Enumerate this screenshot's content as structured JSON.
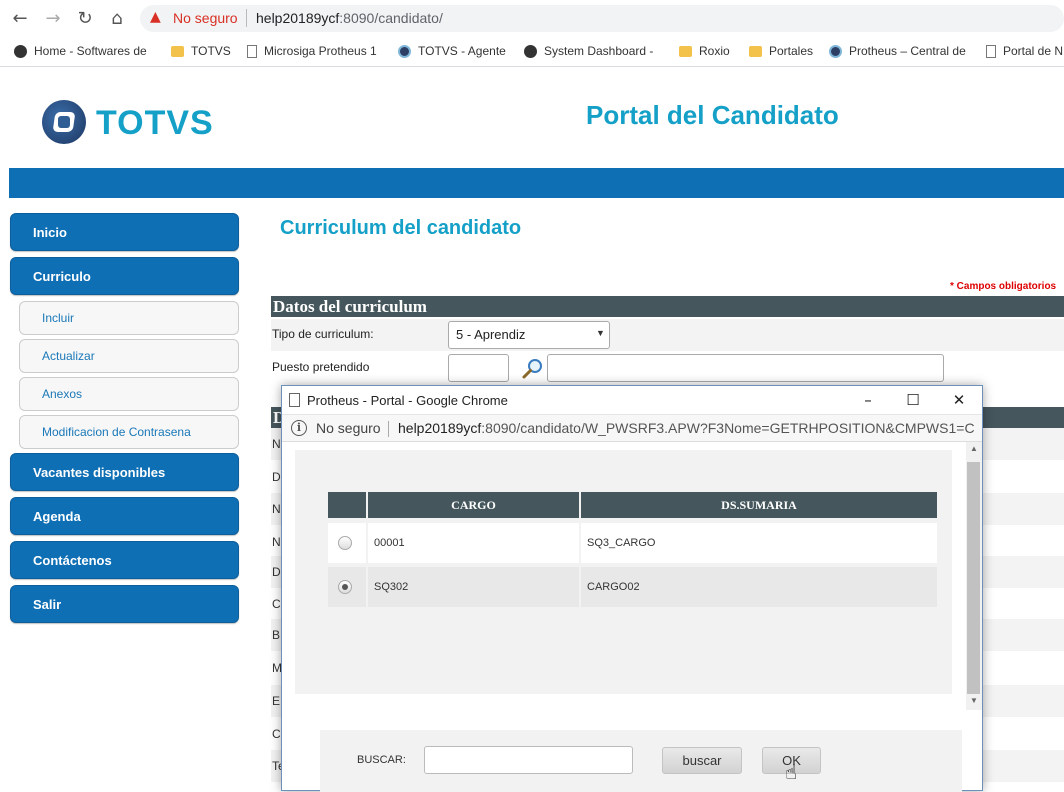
{
  "browser": {
    "nav": {
      "back": "←",
      "forward": "→",
      "reload": "↻",
      "home": "⌂"
    },
    "security_label": "No seguro",
    "url_host": "help20189ycf",
    "url_rest": ":8090/candidato/",
    "bookmarks": [
      {
        "label": "Home - Softwares de",
        "icon": "dark"
      },
      {
        "label": "TOTVS",
        "icon": "folder"
      },
      {
        "label": "Microsiga Protheus 1",
        "icon": "page"
      },
      {
        "label": "TOTVS - Agente",
        "icon": "circle"
      },
      {
        "label": "System Dashboard -",
        "icon": "dark"
      },
      {
        "label": "Roxio",
        "icon": "folder"
      },
      {
        "label": "Portales",
        "icon": "folder"
      },
      {
        "label": "Protheus – Central de",
        "icon": "circle"
      },
      {
        "label": "Portal de N",
        "icon": "page"
      }
    ]
  },
  "header": {
    "logo_text": "TOTVS",
    "portal_title": "Portal del Candidato"
  },
  "sidebar": {
    "items": [
      {
        "label": "Inicio",
        "type": "main"
      },
      {
        "label": "Curriculo",
        "type": "main"
      },
      {
        "label": "Incluir",
        "type": "sub"
      },
      {
        "label": "Actualizar",
        "type": "sub"
      },
      {
        "label": "Anexos",
        "type": "sub"
      },
      {
        "label": "Modificacion de Contrasena",
        "type": "sub"
      },
      {
        "label": "Vacantes disponibles",
        "type": "main"
      },
      {
        "label": "Agenda",
        "type": "main"
      },
      {
        "label": "Contáctenos",
        "type": "main"
      },
      {
        "label": "Salir",
        "type": "main"
      }
    ]
  },
  "main": {
    "title": "Curriculum del candidato",
    "required_note": "* Campos obligatorios",
    "section_title": "Datos del curriculum",
    "tipo_label": "Tipo de curriculum:",
    "tipo_value": "5 - Aprendiz",
    "puesto_label": "Puesto pretendido",
    "section2_initial": "D",
    "side_letters": [
      "N",
      "D",
      "N",
      "N",
      "D",
      "C",
      "B",
      "M",
      "E",
      "C",
      "Te"
    ]
  },
  "popup": {
    "window_title": "Protheus - Portal - Google Chrome",
    "security_label": "No seguro",
    "url_host": "help20189ycf",
    "url_rest": ":8090/candidato/W_PWSRF3.APW?F3Nome=GETRHPOSITION&CMPWS1=C...",
    "columns": [
      "CARGO",
      "DS.SUMARIA"
    ],
    "rows": [
      {
        "cargo": "00001",
        "sumaria": "SQ3_CARGO",
        "selected": false
      },
      {
        "cargo": "SQ302",
        "sumaria": "CARGO02",
        "selected": true
      }
    ],
    "search_label": "BUSCAR:",
    "search_value": "",
    "search_button": "buscar",
    "ok_button": "OK"
  }
}
